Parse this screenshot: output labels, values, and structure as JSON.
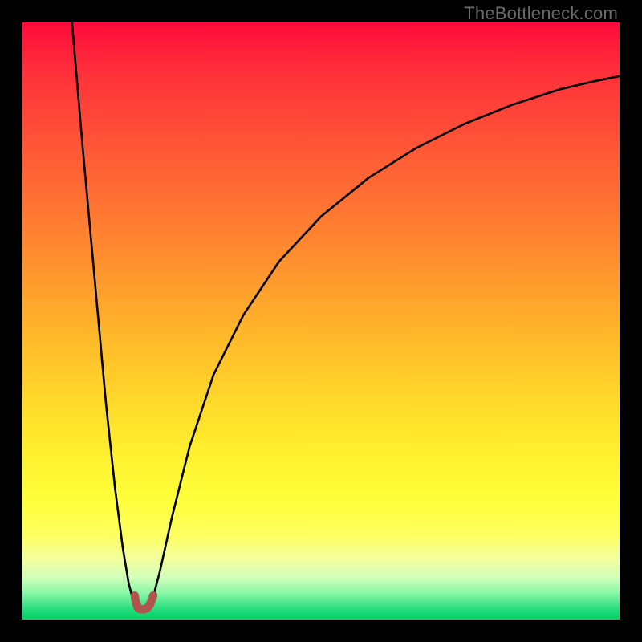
{
  "watermark": {
    "text": "TheBottleneck.com"
  },
  "chart_data": {
    "type": "line",
    "title": "",
    "xlabel": "",
    "ylabel": "",
    "xlim": [
      0,
      100
    ],
    "ylim": [
      0,
      100
    ],
    "grid": false,
    "legend": false,
    "background_gradient": {
      "orientation": "vertical",
      "stops": [
        {
          "pos": 0.0,
          "color": "#ff0a3a"
        },
        {
          "pos": 0.22,
          "color": "#ff5a36"
        },
        {
          "pos": 0.52,
          "color": "#ffb62a"
        },
        {
          "pos": 0.8,
          "color": "#ffff3a"
        },
        {
          "pos": 0.95,
          "color": "#8cf7a8"
        },
        {
          "pos": 1.0,
          "color": "#0acf65"
        }
      ]
    },
    "series": [
      {
        "name": "left-branch",
        "stroke": "#000000",
        "x": [
          8.3,
          10.0,
          12.0,
          14.0,
          15.5,
          16.8,
          17.8,
          18.6,
          19.1
        ],
        "y": [
          100.0,
          80.0,
          58.0,
          36.0,
          22.0,
          12.0,
          6.0,
          3.0,
          2.3
        ]
      },
      {
        "name": "valley-marker",
        "stroke": "#b0544d",
        "x": [
          18.8,
          19.0,
          19.3,
          19.8,
          20.4,
          21.0,
          21.4,
          21.7,
          21.9
        ],
        "y": [
          4.0,
          2.8,
          2.0,
          1.7,
          1.7,
          2.0,
          2.6,
          3.4,
          4.0
        ]
      },
      {
        "name": "right-branch",
        "stroke": "#000000",
        "x": [
          21.5,
          23.0,
          25.0,
          28.0,
          32.0,
          37.0,
          43.0,
          50.0,
          58.0,
          66.0,
          74.0,
          82.0,
          90.0,
          96.0,
          100.0
        ],
        "y": [
          2.3,
          8.0,
          17.0,
          29.0,
          41.0,
          51.0,
          60.0,
          67.5,
          74.0,
          79.0,
          83.0,
          86.2,
          88.8,
          90.2,
          91.0
        ]
      }
    ]
  }
}
